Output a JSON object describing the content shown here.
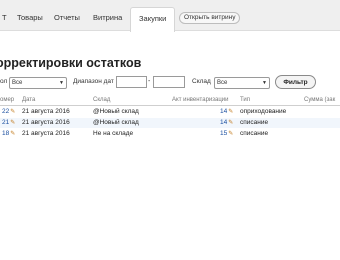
{
  "nav": {
    "items": [
      {
        "label": "Т",
        "active": false
      },
      {
        "label": "Товары",
        "active": false
      },
      {
        "label": "Отчеты",
        "active": false
      },
      {
        "label": "Витрина",
        "active": false
      },
      {
        "label": "Закупки",
        "active": true
      }
    ],
    "open_shop_label": "Открыть витрину"
  },
  "page": {
    "title": "орректировки остатков"
  },
  "filters": {
    "type_label": "ол",
    "type_value": "Все",
    "date_range_label": "Диапазон дат",
    "date_separator": "-",
    "warehouse_label": "Склад",
    "warehouse_value": "Все",
    "filter_button": "Фильтр"
  },
  "table": {
    "columns": [
      "омер",
      "Дата",
      "Склад",
      "Акт инвентаризации",
      "Тип",
      "Сумма (зак"
    ],
    "rows": [
      {
        "num": "22",
        "date": "21 августа 2016",
        "warehouse": "@Новый склад",
        "inventory": "14",
        "type": "оприходование"
      },
      {
        "num": "21",
        "date": "21 августа 2016",
        "warehouse": "@Новый склад",
        "inventory": "14",
        "type": "списание"
      },
      {
        "num": "18",
        "date": "21 августа 2016",
        "warehouse": "Не на складе",
        "inventory": "15",
        "type": "списание"
      }
    ]
  },
  "colors": {
    "accent_link": "#1a4fa0",
    "row_highlight": "#f1f6fc",
    "nav_bg": "#efefef"
  },
  "icons": {
    "edit": "pencil-icon"
  }
}
